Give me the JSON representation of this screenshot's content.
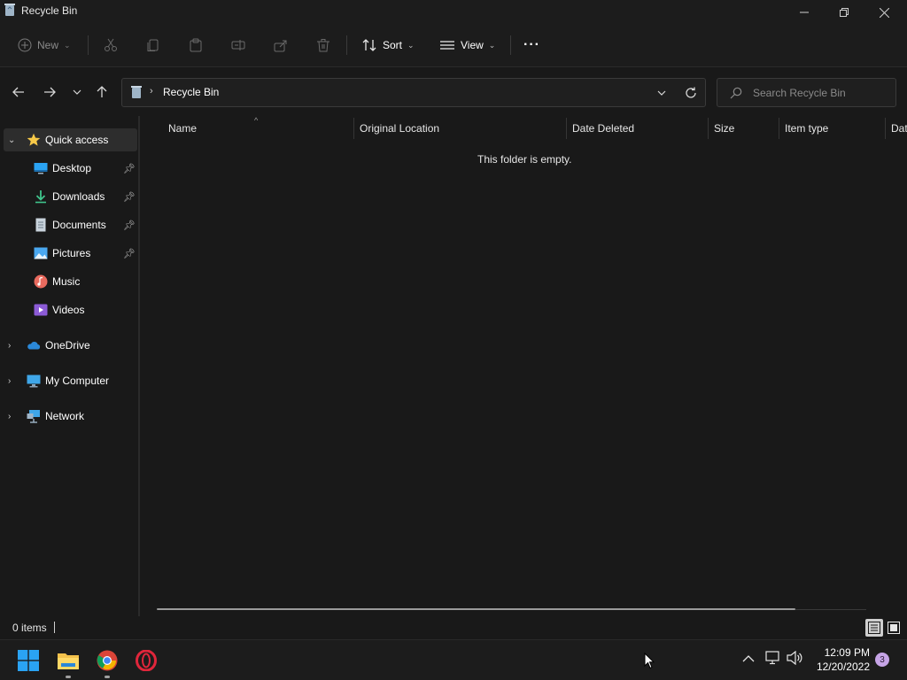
{
  "window": {
    "title": "Recycle Bin",
    "controls": {
      "minimize": "minimize",
      "maximize": "restore",
      "close": "close"
    }
  },
  "toolbar": {
    "new_label": "New",
    "sort_label": "Sort",
    "view_label": "View",
    "more_label": "···"
  },
  "address": {
    "breadcrumb": "Recycle Bin"
  },
  "search": {
    "placeholder": "Search Recycle Bin"
  },
  "sidebar": {
    "items": [
      {
        "label": "Quick access",
        "icon": "star-icon"
      },
      {
        "label": "Desktop",
        "icon": "desktop-icon"
      },
      {
        "label": "Downloads",
        "icon": "download-icon"
      },
      {
        "label": "Documents",
        "icon": "document-icon"
      },
      {
        "label": "Pictures",
        "icon": "picture-icon"
      },
      {
        "label": "Music",
        "icon": "music-icon"
      },
      {
        "label": "Videos",
        "icon": "video-icon"
      },
      {
        "label": "OneDrive",
        "icon": "cloud-icon"
      },
      {
        "label": "My Computer",
        "icon": "computer-icon"
      },
      {
        "label": "Network",
        "icon": "network-icon"
      }
    ]
  },
  "table": {
    "columns": [
      "Name",
      "Original Location",
      "Date Deleted",
      "Size",
      "Item type",
      "Dat"
    ],
    "empty_message": "This folder is empty."
  },
  "status": {
    "item_count": "0 items"
  },
  "taskbar": {
    "clock_time": "12:09 PM",
    "clock_date": "12/20/2022",
    "notification_count": "3"
  },
  "colors": {
    "background": "#191919",
    "accent_star": "#f7c948",
    "folder_yellow": "#f3c14b",
    "windows_blue": "#2aa3f3"
  }
}
